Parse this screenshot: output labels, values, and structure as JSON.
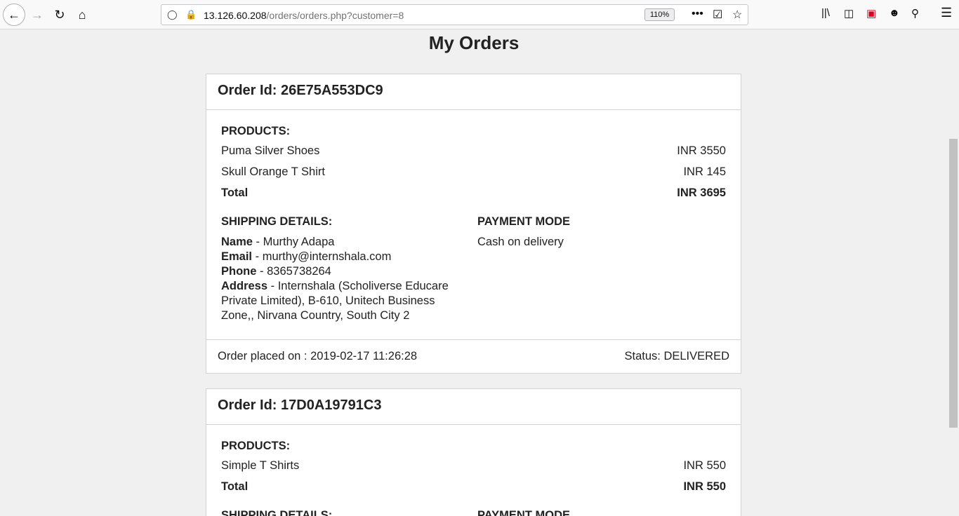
{
  "browser": {
    "url_host": "13.126.60.208",
    "url_path": "/orders/orders.php?customer=8",
    "zoom": "110%"
  },
  "page": {
    "title": "My Orders"
  },
  "labels": {
    "products": "PRODUCTS:",
    "total": "Total",
    "shipping": "SHIPPING DETAILS:",
    "payment": "PAYMENT MODE",
    "name": "Name",
    "email": "Email",
    "phone": "Phone",
    "address": "Address"
  },
  "orders": [
    {
      "order_id": "Order Id: 26E75A553DC9",
      "products": [
        {
          "name": "Puma Silver Shoes",
          "price": "INR 3550"
        },
        {
          "name": "Skull Orange T Shirt",
          "price": "INR 145"
        }
      ],
      "total": "INR 3695",
      "shipping": {
        "name": " - Murthy Adapa",
        "email": " - murthy@internshala.com",
        "phone": " - 8365738264",
        "address": " - Internshala (Scholiverse Educare Private Limited), B-610, Unitech Business Zone,, Nirvana Country, South City 2"
      },
      "payment_mode": "Cash on delivery",
      "placed_on": "Order placed on : 2019-02-17 11:26:28",
      "status": "Status: DELIVERED"
    },
    {
      "order_id": "Order Id: 17D0A19791C3",
      "products": [
        {
          "name": "Simple T Shirts",
          "price": "INR 550"
        }
      ],
      "total": "INR 550"
    }
  ]
}
